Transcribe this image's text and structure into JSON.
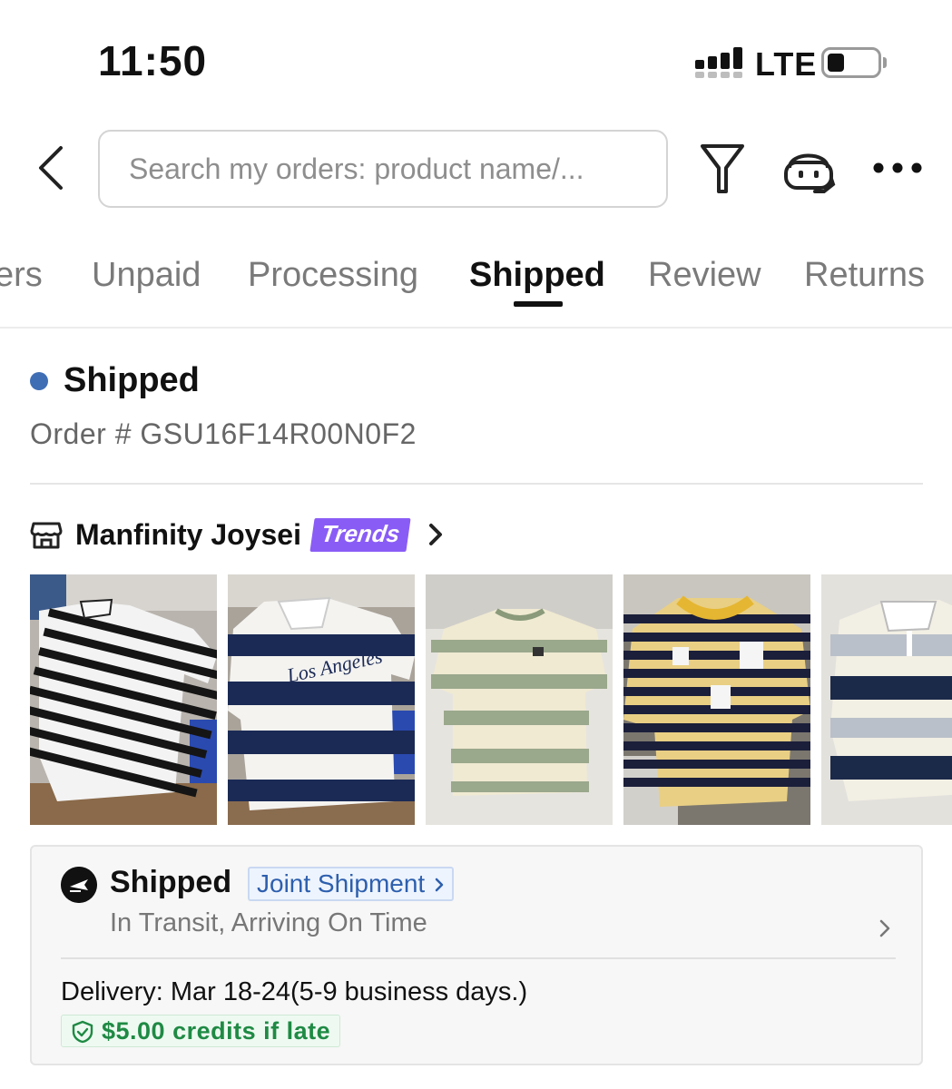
{
  "status_bar": {
    "time": "11:50",
    "network": "LTE"
  },
  "header": {
    "search_placeholder": "Search my orders: product name/..."
  },
  "tabs": [
    {
      "label": "ers",
      "active": false
    },
    {
      "label": "Unpaid",
      "active": false
    },
    {
      "label": "Processing",
      "active": false
    },
    {
      "label": "Shipped",
      "active": true
    },
    {
      "label": "Review",
      "active": false
    },
    {
      "label": "Returns",
      "active": false
    }
  ],
  "order": {
    "status": "Shipped",
    "number": "Order # GSU16F14R00N0F2",
    "status_color": "#3f6eb5"
  },
  "store": {
    "name": "Manfinity Joysei",
    "badge": "Trends",
    "badge_color": "#8a5cf6"
  },
  "products": [
    {
      "name": "black-white-striped-tshirt"
    },
    {
      "name": "navy-white-striped-polo-los-angeles"
    },
    {
      "name": "green-cream-striped-tshirt"
    },
    {
      "name": "navy-yellow-striped-tshirt"
    },
    {
      "name": "navy-grey-striped-polo"
    }
  ],
  "shipment": {
    "title": "Shipped",
    "joint_label": "Joint Shipment",
    "subtitle": "In Transit, Arriving On Time",
    "delivery": "Delivery: Mar 18-24(5-9 business days.)",
    "credits": "$5.00 credits if late",
    "accent_blue": "#2d5fae",
    "accent_green": "#1f8a44"
  }
}
